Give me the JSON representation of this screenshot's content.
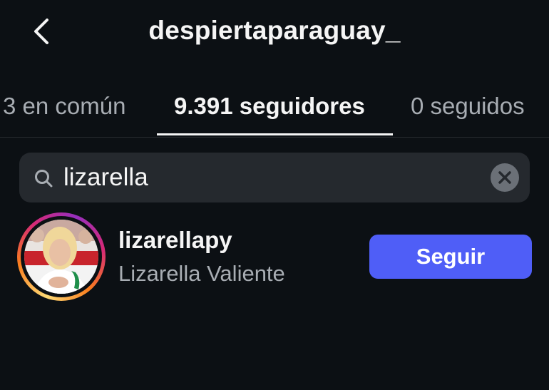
{
  "header": {
    "title": "despiertaparaguay_",
    "back_icon": "chevron-left-icon"
  },
  "tabs": [
    {
      "label": "3 en común",
      "active": false
    },
    {
      "label": "9.391 seguidores",
      "active": true
    },
    {
      "label": "0 seguidos",
      "active": false
    }
  ],
  "search": {
    "value": "lizarella",
    "icon": "search-icon",
    "clear_icon": "clear-icon"
  },
  "results": [
    {
      "username": "lizarellapy",
      "full_name": "Lizarella Valiente",
      "follow_label": "Seguir"
    }
  ],
  "colors": {
    "background": "#0c1014",
    "follow_button": "#4f5ef7",
    "search_field": "#25292e",
    "secondary_text": "#a8adb3"
  }
}
